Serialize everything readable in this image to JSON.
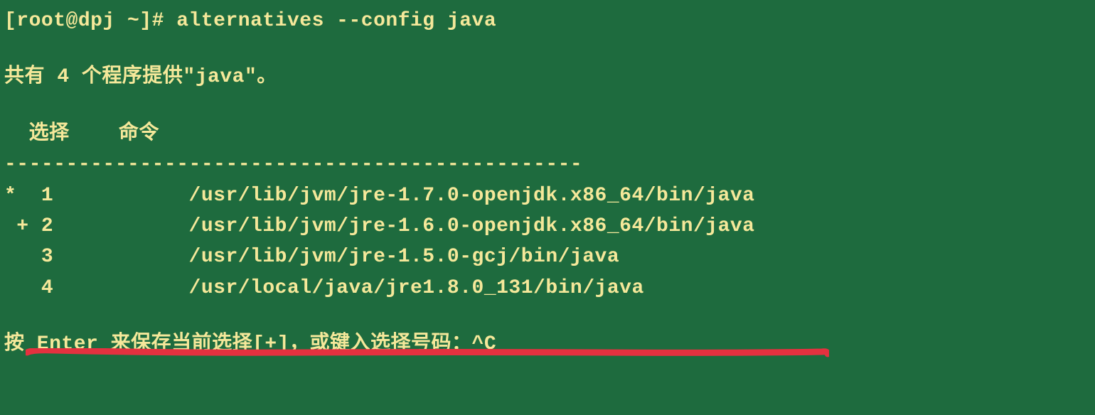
{
  "prompt": {
    "user_host": "[root@dpj ~]#",
    "command": "alternatives --config java"
  },
  "summary_prefix": "共有 ",
  "summary_count": "4",
  "summary_suffix": " 个程序提供\"java\"。",
  "header": {
    "selection": "  选择    命令",
    "divider": "-----------------------------------------------"
  },
  "alternatives": [
    {
      "marker": "*  1           ",
      "path": "/usr/lib/jvm/jre-1.7.0-openjdk.x86_64/bin/java"
    },
    {
      "marker": " + 2           ",
      "path": "/usr/lib/jvm/jre-1.6.0-openjdk.x86_64/bin/java"
    },
    {
      "marker": "   3           ",
      "path": "/usr/lib/jvm/jre-1.5.0-gcj/bin/java"
    },
    {
      "marker": "   4           ",
      "path": "/usr/local/java/jre1.8.0_131/bin/java"
    }
  ],
  "footer_prompt": "按 Enter 来保存当前选择[+]，或键入选择号码：",
  "footer_input": "^C",
  "annotation_color": "#e4313f"
}
